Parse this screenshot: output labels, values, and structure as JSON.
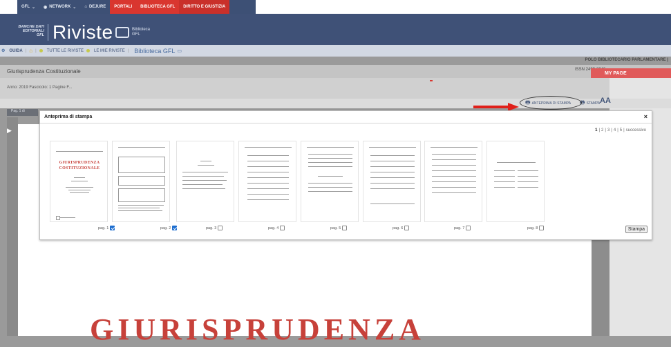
{
  "topnav": {
    "items": [
      {
        "label": "GFL",
        "icon": "chevron-down-icon"
      },
      {
        "label": "NETWORK",
        "icon": "globe-icon"
      },
      {
        "label": "DEJURE",
        "icon": "home-icon"
      },
      {
        "label": "PORTALI"
      },
      {
        "label": "BIBLIOTECA GFL"
      },
      {
        "label": "DIRITTO E GIUSTIZIA"
      }
    ],
    "colors": {
      "bar": "#3d5075",
      "accent": "#d9362f"
    }
  },
  "header": {
    "logo_small": [
      "BANCHE DATI",
      "EDITORIALI",
      "GFL"
    ],
    "title": "Riviste",
    "biblioteca_line1": "Biblioteca",
    "biblioteca_line2": "GFL"
  },
  "breadcrumb": {
    "guida": "GUIDA",
    "tutte": "TUTTE LE RIVISTE",
    "mie": "LE MIE RIVISTE",
    "biblioteca": "Biblioteca GFL"
  },
  "account": {
    "polo": "POLO BIBLIOTECARIO PARLAMENTARE |",
    "my_page": "MY PAGE"
  },
  "journal": {
    "title": "Giurisprudenza Costituzionale",
    "issn": "ISSN 2499-2046",
    "anno": "Anno: 2019 Fascicolo: 1 Pagine F..."
  },
  "toolbar": {
    "anteprima": "ANTEPRIMA DI STAMPA",
    "stampa": "STAMPA",
    "font_size": "AA"
  },
  "viewer": {
    "page_label": "Pag. 1 di",
    "big_title": "GIURISPRUDENZA"
  },
  "dialog": {
    "title": "Anteprima di stampa",
    "close": "×",
    "pagination": {
      "pages": [
        "1",
        "2",
        "3",
        "4",
        "5"
      ],
      "current": "1",
      "next": "successivo"
    },
    "thumbs": [
      {
        "label": "pag. 1",
        "checked": true
      },
      {
        "label": "pag. 2",
        "checked": true
      },
      {
        "label": "pag. 3",
        "checked": false
      },
      {
        "label": "pag. 4",
        "checked": false
      },
      {
        "label": "pag. 5",
        "checked": false
      },
      {
        "label": "pag. 6",
        "checked": false
      },
      {
        "label": "pag. 7",
        "checked": false
      },
      {
        "label": "pag. 8",
        "checked": false
      }
    ],
    "thumb1_title": [
      "GIURISPRUDENZA",
      "COSTITUZIONALE"
    ],
    "stampa_button": "Stampa"
  }
}
